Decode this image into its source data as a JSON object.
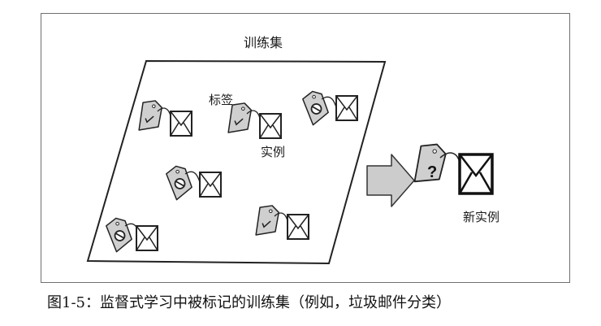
{
  "diagram": {
    "training_set_label": "训练集",
    "label_annotation": "标签",
    "instance_annotation": "实例",
    "new_instance_label": "新实例",
    "question_mark": "?",
    "icons": [
      "tag-check-icon",
      "tag-ban-icon",
      "tag-question-icon",
      "envelope-icon",
      "arrow-right-icon"
    ],
    "colors": {
      "tag_fill": "#cfcfcf",
      "arrow_fill": "#cccccc",
      "stroke": "#222222"
    }
  },
  "caption": "图1-5：监督式学习中被标记的训练集（例如，垃圾邮件分类）"
}
